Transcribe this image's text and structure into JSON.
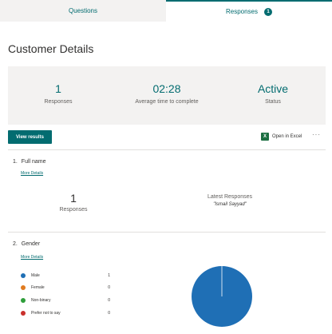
{
  "tabs": [
    {
      "label": "Questions"
    },
    {
      "label": "Responses",
      "badge": "1"
    }
  ],
  "form": {
    "title": "Customer Details",
    "stats": {
      "responses": {
        "value": "1",
        "label": "Responses"
      },
      "avg_time": {
        "value": "02:28",
        "label": "Average time to complete"
      },
      "status": {
        "value": "Active",
        "label": "Status"
      }
    },
    "view_results_label": "View results",
    "open_in_excel_label": "Open in Excel",
    "more_icon": "···"
  },
  "questions": [
    {
      "number": "1.",
      "title": "Full name",
      "more_details": "More Details",
      "responses_value": "1",
      "responses_label": "Responses",
      "latest_header": "Latest Responses",
      "latest_name": "\"Ismail Sayyad\""
    },
    {
      "number": "2.",
      "title": "Gender",
      "more_details": "More Details",
      "options": [
        {
          "label": "Male",
          "count": "1",
          "color": "#1f6fb5"
        },
        {
          "label": "Female",
          "count": "0",
          "color": "#e07b1f"
        },
        {
          "label": "Non-binary",
          "count": "0",
          "color": "#2e9e3a"
        },
        {
          "label": "Prefer not to say",
          "count": "0",
          "color": "#c9302c"
        }
      ]
    }
  ],
  "colors": {
    "accent": "#036c70",
    "pie_male": "#1f6fb5"
  }
}
